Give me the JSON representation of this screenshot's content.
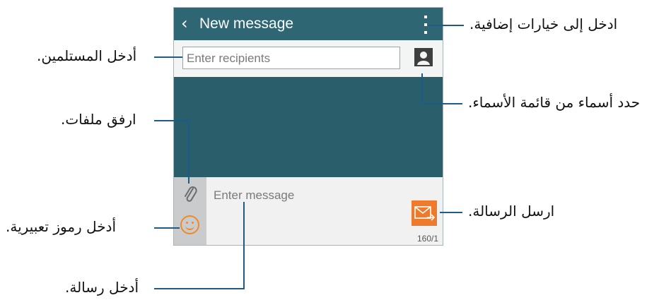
{
  "app": {
    "back_icon": "chevron-left-icon",
    "title": "New message",
    "more_icon": "more-options-icon"
  },
  "recipients": {
    "placeholder": "Enter recipients",
    "contacts_icon": "contact-icon"
  },
  "compose": {
    "attach_icon": "paperclip-icon",
    "emoticon_icon": "smiley-icon",
    "placeholder": "Enter message",
    "send_icon": "send-envelope-icon",
    "counter": "160/1"
  },
  "annotations": {
    "more_options": "ادخل إلى خيارات إضافية.",
    "enter_recipients": "أدخل المستلمين.",
    "select_contacts": "حدد أسماء من قائمة الأسماء.",
    "attach_files": "ارفق ملفات.",
    "send_message": "ارسل الرسالة.",
    "insert_emoticons": "أدخل رموز تعبيرية.",
    "enter_message": "أدخل رسالة."
  },
  "colors": {
    "appbar": "#2f6673",
    "body": "#2a5e6a",
    "accent": "#ee7a2b",
    "leader_line": "#1e5b86"
  }
}
